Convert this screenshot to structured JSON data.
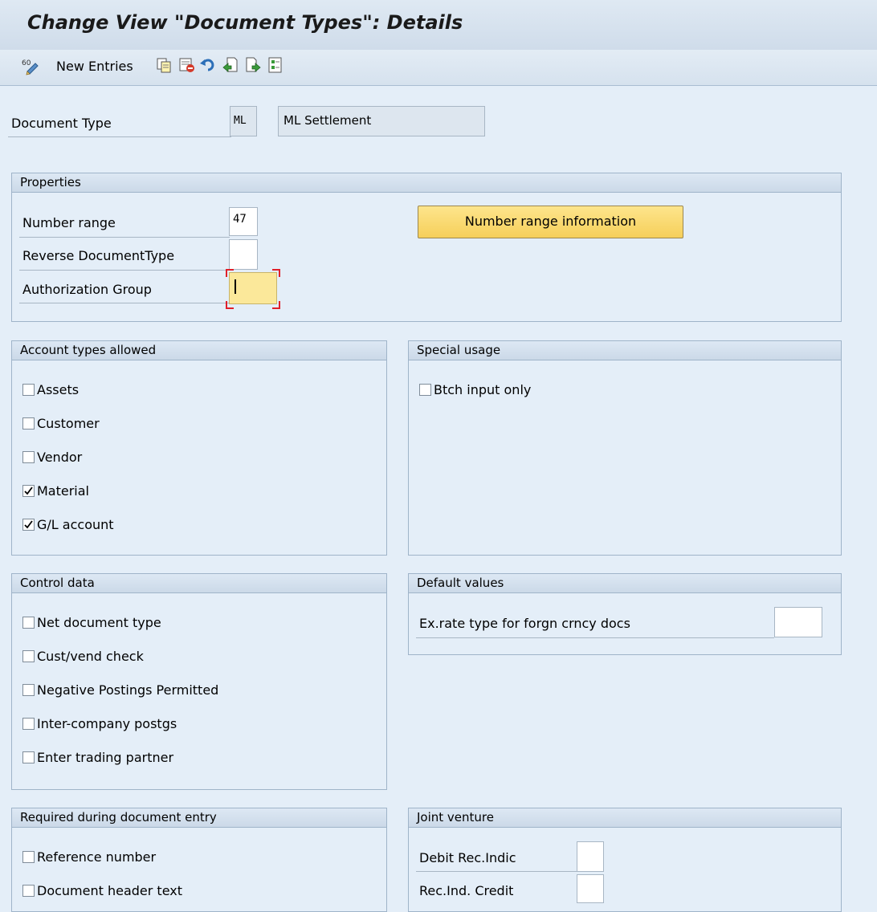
{
  "title": "Change View \"Document Types\": Details",
  "toolbar": {
    "new_entries": "New Entries",
    "icons": [
      "display-change-icon",
      "copy-icon",
      "delete-icon",
      "undo-icon",
      "previous-entry-icon",
      "next-entry-icon",
      "select-all-icon"
    ]
  },
  "header": {
    "document_type_label": "Document Type",
    "document_type_code": "ML",
    "document_type_desc": "ML Settlement"
  },
  "properties": {
    "title": "Properties",
    "number_range_label": "Number range",
    "number_range_value": "47",
    "reverse_doc_type_label": "Reverse DocumentType",
    "reverse_doc_type_value": "",
    "authorization_group_label": "Authorization Group",
    "authorization_group_value": "",
    "number_range_info_button": "Number range information"
  },
  "account_types": {
    "title": "Account types allowed",
    "items": [
      {
        "label": "Assets",
        "checked": false
      },
      {
        "label": "Customer",
        "checked": false
      },
      {
        "label": "Vendor",
        "checked": false
      },
      {
        "label": "Material",
        "checked": true
      },
      {
        "label": "G/L account",
        "checked": true
      }
    ]
  },
  "special_usage": {
    "title": "Special usage",
    "items": [
      {
        "label": "Btch input only",
        "checked": false
      }
    ]
  },
  "control_data": {
    "title": "Control data",
    "items": [
      {
        "label": "Net document type",
        "checked": false
      },
      {
        "label": "Cust/vend check",
        "checked": false
      },
      {
        "label": "Negative Postings Permitted",
        "checked": false
      },
      {
        "label": "Inter-company postgs",
        "checked": false
      },
      {
        "label": "Enter trading partner",
        "checked": false
      }
    ]
  },
  "default_values": {
    "title": "Default values",
    "ex_rate_label": "Ex.rate type for forgn crncy docs",
    "ex_rate_value": ""
  },
  "required_entry": {
    "title": "Required during document entry",
    "items": [
      {
        "label": "Reference number",
        "checked": false
      },
      {
        "label": "Document header text",
        "checked": false
      }
    ]
  },
  "joint_venture": {
    "title": "Joint venture",
    "debit_label": "Debit Rec.Indic",
    "debit_value": "",
    "credit_label": "Rec.Ind. Credit",
    "credit_value": ""
  }
}
